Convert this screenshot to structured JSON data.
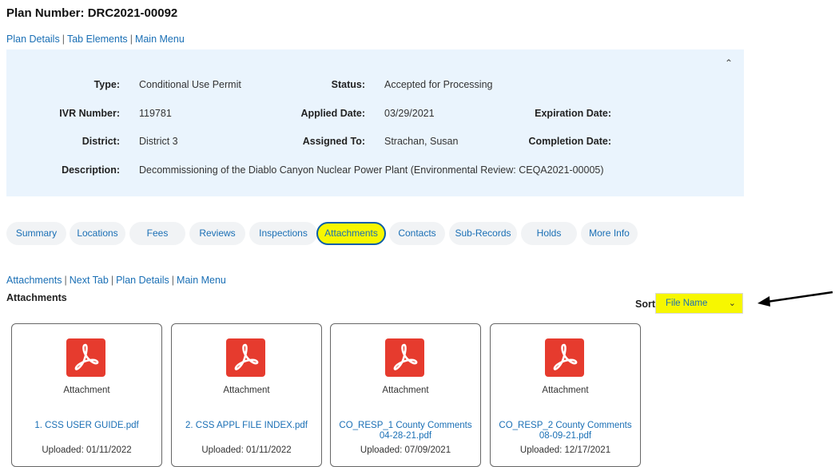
{
  "header": {
    "title_prefix": "Plan Number:",
    "plan_number": "DRC2021-00092"
  },
  "top_nav": [
    "Plan Details",
    "Tab Elements",
    "Main Menu"
  ],
  "details": {
    "type_label": "Type:",
    "type_value": "Conditional Use Permit",
    "status_label": "Status:",
    "status_value": "Accepted for Processing",
    "ivr_label": "IVR Number:",
    "ivr_value": "119781",
    "applied_label": "Applied Date:",
    "applied_value": "03/29/2021",
    "expiration_label": "Expiration Date:",
    "expiration_value": "",
    "district_label": "District:",
    "district_value": "District 3",
    "assigned_label": "Assigned To:",
    "assigned_value": "Strachan, Susan",
    "completion_label": "Completion Date:",
    "completion_value": "",
    "description_label": "Description:",
    "description_value": "Decommissioning of the Diablo Canyon Nuclear Power Plant (Environmental Review: CEQA2021-00005)",
    "collapse_icon": "chevron-up-icon"
  },
  "tabs": [
    {
      "label": "Summary"
    },
    {
      "label": "Locations"
    },
    {
      "label": "Fees"
    },
    {
      "label": "Reviews"
    },
    {
      "label": "Inspections"
    },
    {
      "label": "Attachments",
      "active": true
    },
    {
      "label": "Contacts"
    },
    {
      "label": "Sub-Records"
    },
    {
      "label": "Holds"
    },
    {
      "label": "More Info"
    }
  ],
  "attachments_nav": [
    "Attachments",
    "Next Tab",
    "Plan Details",
    "Main Menu"
  ],
  "attachments": {
    "heading": "Attachments",
    "sort_label": "Sort",
    "sort_value": "File Name",
    "highlight_color": "#f7f700",
    "items": [
      {
        "kind": "Attachment",
        "file_name": "1. CSS USER GUIDE.pdf",
        "uploaded": "Uploaded: 01/11/2022"
      },
      {
        "kind": "Attachment",
        "file_name": "2. CSS APPL FILE INDEX.pdf",
        "uploaded": "Uploaded: 01/11/2022"
      },
      {
        "kind": "Attachment",
        "file_name": "CO_RESP_1 County Comments 04-28-21.pdf",
        "uploaded": "Uploaded: 07/09/2021"
      },
      {
        "kind": "Attachment",
        "file_name": "CO_RESP_2 County Comments 08-09-21.pdf",
        "uploaded": "Uploaded: 12/17/2021"
      }
    ]
  },
  "colors": {
    "link": "#1a6fb5",
    "panel_bg": "#eaf4fd",
    "pdf_red": "#e63b2e",
    "active_tab_border": "#0b5ea8"
  }
}
